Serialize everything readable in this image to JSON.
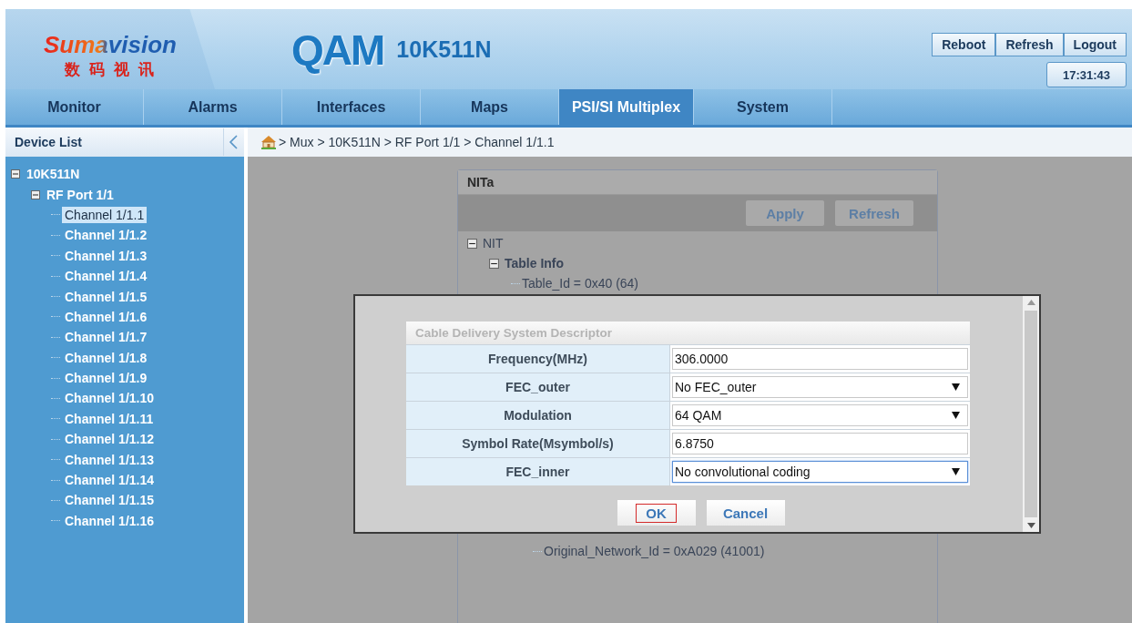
{
  "header": {
    "logo": {
      "name": "Sumavision",
      "tagline": "数 码 视 讯"
    },
    "product": "QAM",
    "model": "10K511N",
    "buttons": [
      "Reboot",
      "Refresh",
      "Logout"
    ],
    "time": "17:31:43"
  },
  "nav": [
    {
      "label": "Monitor",
      "selected": false
    },
    {
      "label": "Alarms",
      "selected": false
    },
    {
      "label": "Interfaces",
      "selected": false
    },
    {
      "label": "Maps",
      "selected": false
    },
    {
      "label": "PSI/SI Multiplex",
      "selected": true
    },
    {
      "label": "System",
      "selected": false
    }
  ],
  "sidebar": {
    "title": "Device List",
    "tree": [
      {
        "label": "10K511N",
        "expanded": true,
        "children": [
          {
            "label": "RF Port 1/1",
            "expanded": true,
            "children": [
              {
                "label": "Channel 1/1.1",
                "selected": true
              },
              {
                "label": "Channel 1/1.2",
                "selected": false
              },
              {
                "label": "Channel 1/1.3",
                "selected": false
              },
              {
                "label": "Channel 1/1.4",
                "selected": false
              },
              {
                "label": "Channel 1/1.5",
                "selected": false
              },
              {
                "label": "Channel 1/1.6",
                "selected": false
              },
              {
                "label": "Channel 1/1.7",
                "selected": false
              },
              {
                "label": "Channel 1/1.8",
                "selected": false
              },
              {
                "label": "Channel 1/1.9",
                "selected": false
              },
              {
                "label": "Channel 1/1.10",
                "selected": false
              },
              {
                "label": "Channel 1/1.11",
                "selected": false
              },
              {
                "label": "Channel 1/1.12",
                "selected": false
              },
              {
                "label": "Channel 1/1.13",
                "selected": false
              },
              {
                "label": "Channel 1/1.14",
                "selected": false
              },
              {
                "label": "Channel 1/1.15",
                "selected": false
              },
              {
                "label": "Channel 1/1.16",
                "selected": false
              }
            ]
          }
        ]
      }
    ]
  },
  "breadcrumb": [
    "> Mux > 10K511N > RF Port 1/1 > Channel 1/1.1"
  ],
  "panel": {
    "title": "NITa",
    "buttons": [
      "Apply",
      "Refresh"
    ],
    "tree": [
      {
        "label": "NIT",
        "expanded": true,
        "children": [
          {
            "label": "Table Info",
            "expanded": true,
            "children": [
              {
                "label": "Table_Id = 0x40 (64)"
              }
            ]
          }
        ]
      }
    ],
    "tail": [
      "Original_Network_Id = 0xA029 (41001)"
    ]
  },
  "dialog": {
    "title": "Cable Delivery System Descriptor",
    "rows": [
      {
        "label": "Frequency(MHz)",
        "kind": "text",
        "value": "306.0000",
        "focused": false
      },
      {
        "label": "FEC_outer",
        "kind": "select",
        "value": "No FEC_outer",
        "focused": false
      },
      {
        "label": "Modulation",
        "kind": "select",
        "value": "64 QAM",
        "focused": false
      },
      {
        "label": "Symbol Rate(Msymbol/s)",
        "kind": "text",
        "value": "6.8750",
        "focused": false
      },
      {
        "label": "FEC_inner",
        "kind": "select",
        "value": "No convolutional coding",
        "focused": true
      }
    ],
    "buttons": [
      {
        "label": "OK",
        "focused": true
      },
      {
        "label": "Cancel",
        "focused": false
      }
    ]
  }
}
